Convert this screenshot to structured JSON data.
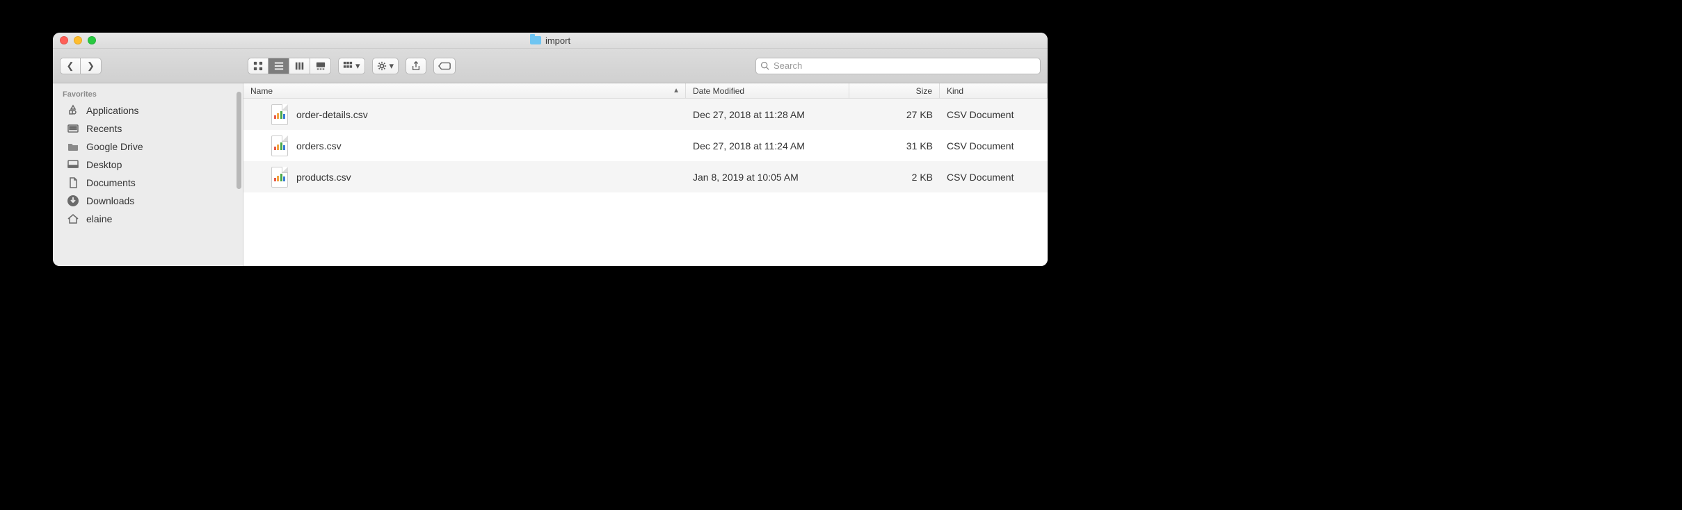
{
  "window": {
    "title": "import"
  },
  "search": {
    "placeholder": "Search"
  },
  "sidebar": {
    "header": "Favorites",
    "items": [
      {
        "label": "Applications"
      },
      {
        "label": "Recents"
      },
      {
        "label": "Google Drive"
      },
      {
        "label": "Desktop"
      },
      {
        "label": "Documents"
      },
      {
        "label": "Downloads"
      },
      {
        "label": "elaine"
      }
    ]
  },
  "columns": {
    "name": "Name",
    "date": "Date Modified",
    "size": "Size",
    "kind": "Kind"
  },
  "files": [
    {
      "name": "order-details.csv",
      "date": "Dec 27, 2018 at 11:28 AM",
      "size": "27 KB",
      "kind": "CSV Document"
    },
    {
      "name": "orders.csv",
      "date": "Dec 27, 2018 at 11:24 AM",
      "size": "31 KB",
      "kind": "CSV Document"
    },
    {
      "name": "products.csv",
      "date": "Jan 8, 2019 at 10:05 AM",
      "size": "2 KB",
      "kind": "CSV Document"
    }
  ]
}
